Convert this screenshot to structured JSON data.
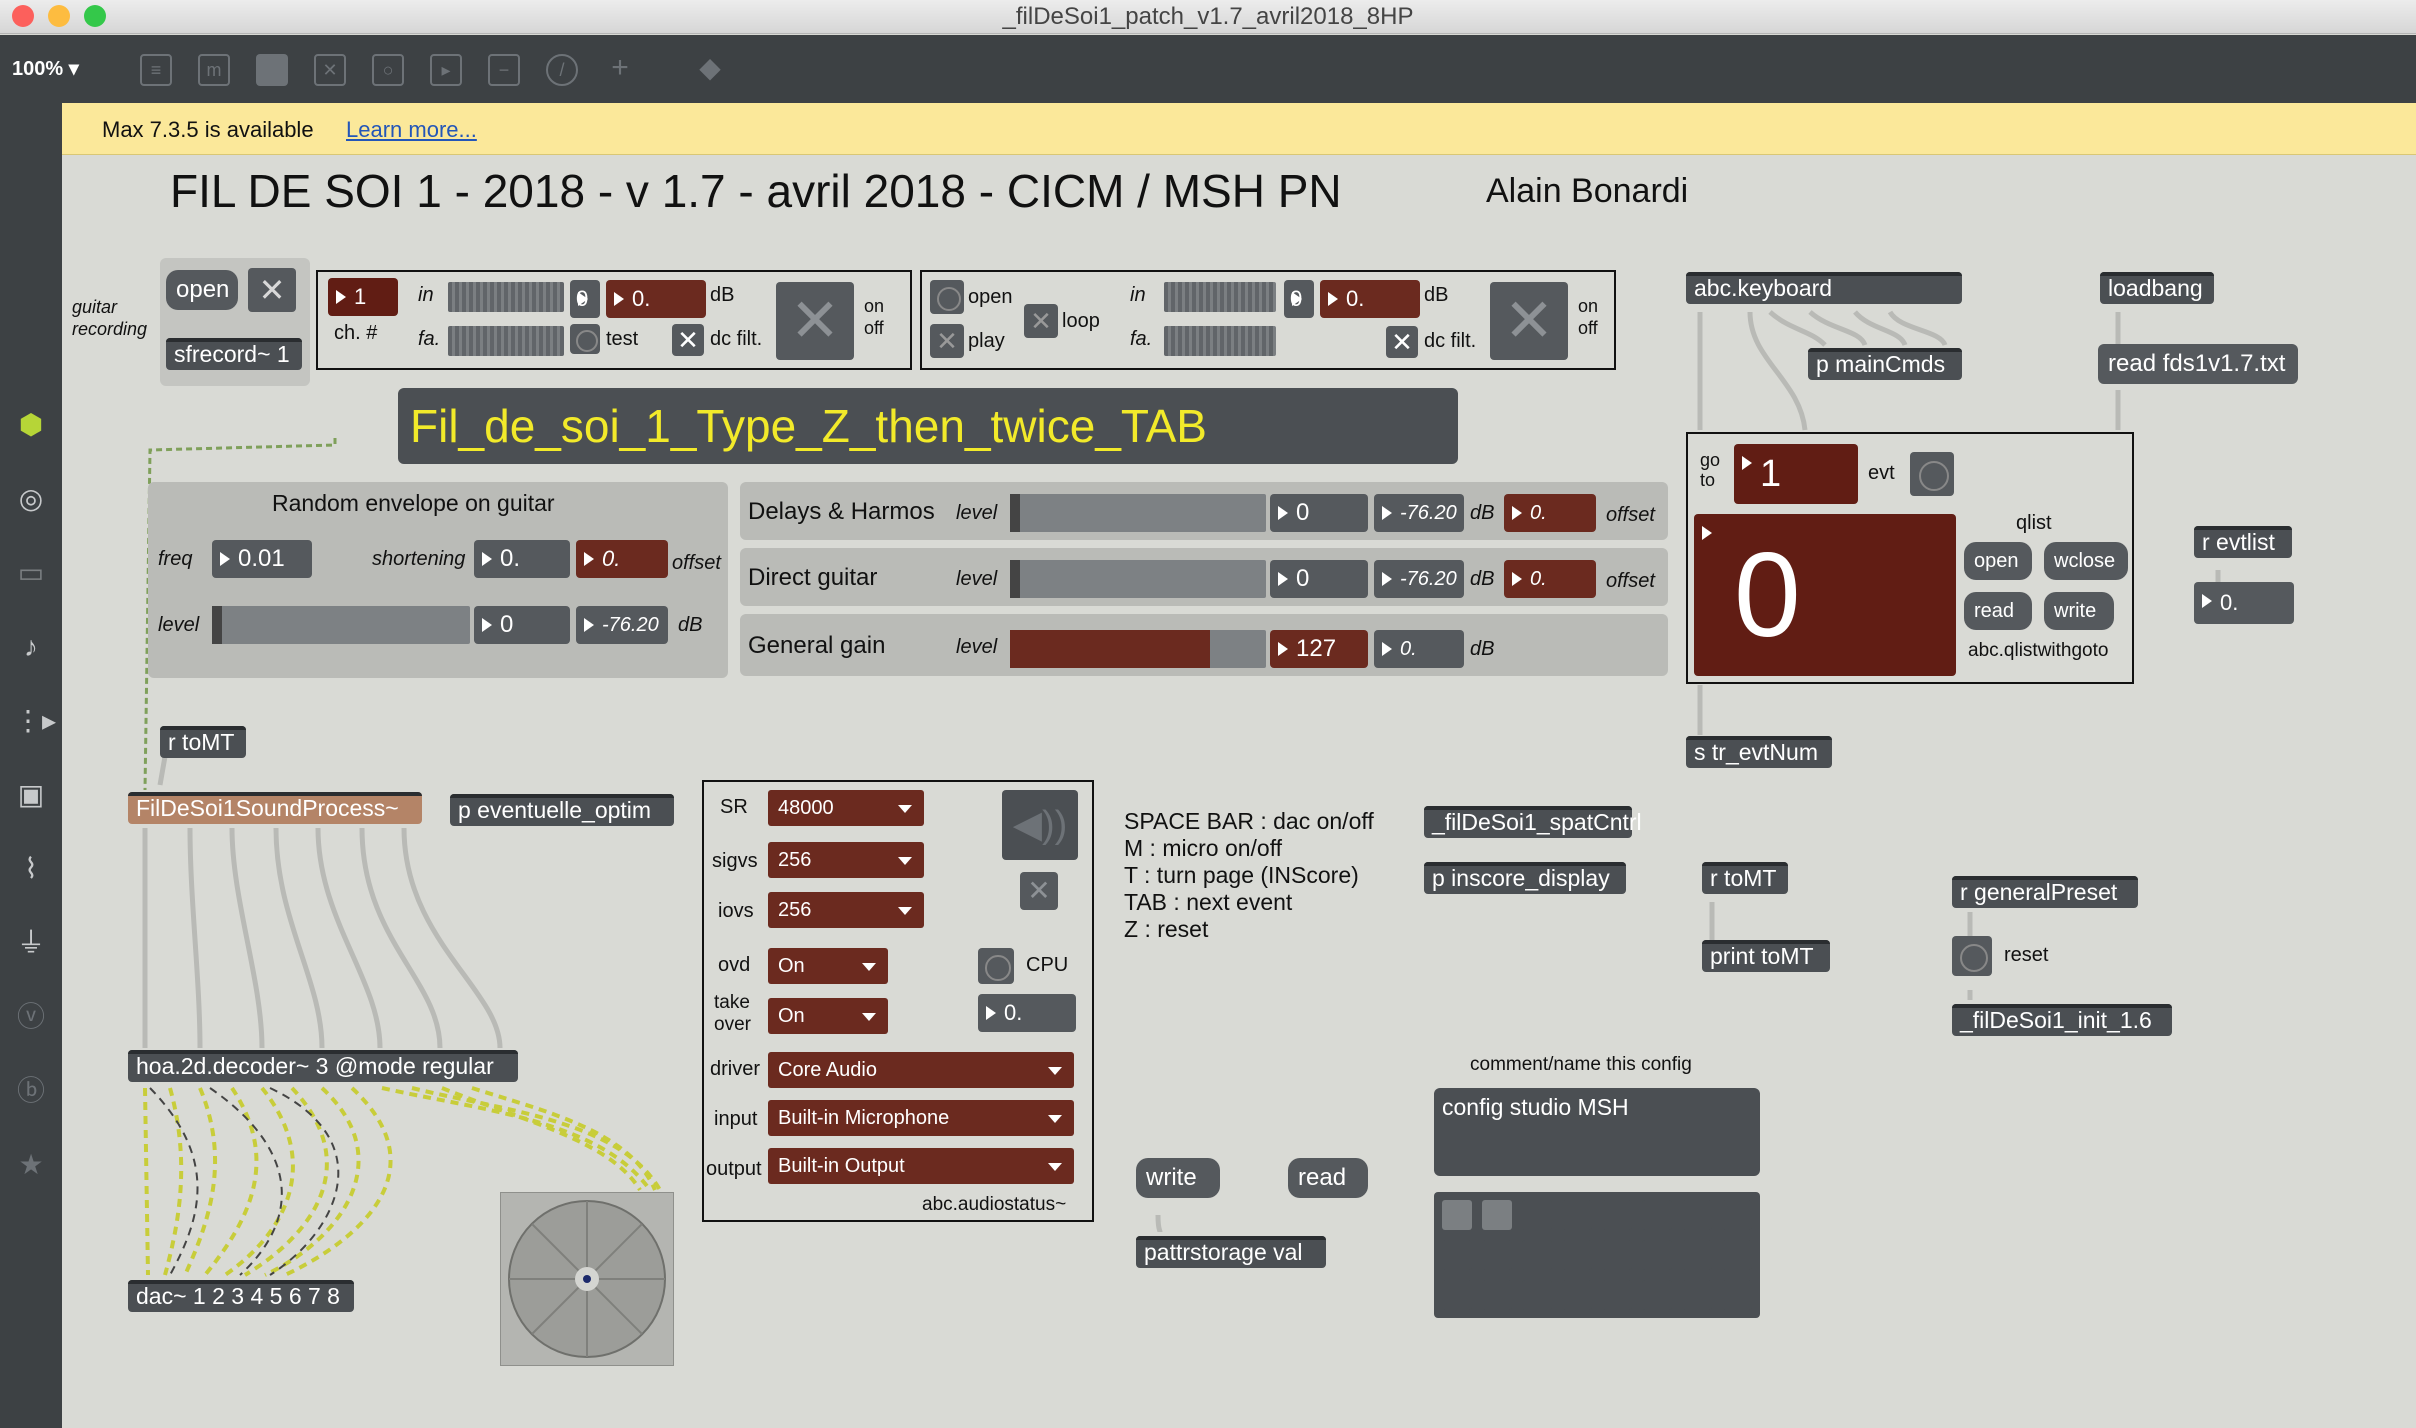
{
  "window": {
    "title": "_filDeSoi1_patch_v1.7_avril2018_8HP",
    "zoom": "100%"
  },
  "notice": {
    "text": "Max 7.3.5 is available",
    "link": "Learn more..."
  },
  "header": {
    "title": "FIL DE SOI 1 - 2018 - v 1.7 - avril 2018 - CICM / MSH PN",
    "author": "Alain Bonardi"
  },
  "recording": {
    "label": "guitar\nrecording",
    "open": "open",
    "sfrecord": "sfrecord~ 1"
  },
  "input1": {
    "ch": "1",
    "ch_label": "ch. #",
    "in": "in",
    "fa": "fa.",
    "zero": "0",
    "db_val": "0.",
    "db": "dB",
    "test": "test",
    "dcfilt": "dc filt.",
    "on": "on",
    "off": "off"
  },
  "input2": {
    "open": "open",
    "play": "play",
    "loop": "loop",
    "in": "in",
    "fa": "fa.",
    "zero": "0",
    "db_val": "0.",
    "db": "dB",
    "dcfilt": "dc filt.",
    "on": "on",
    "off": "off"
  },
  "banner": "Fil_de_soi_1_Type_Z_then_twice_TAB",
  "envelope": {
    "title": "Random envelope on guitar",
    "freq": "freq",
    "freq_val": "0.01",
    "shortening": "shortening",
    "short_val": "0.",
    "offset_val": "0.",
    "offset": "offset",
    "level": "level",
    "level_val": "0",
    "db_val": "-76.20",
    "db": "dB"
  },
  "mixer": [
    {
      "name": "Delays & Harmos",
      "level": "level",
      "val": "0",
      "db_val": "-76.20",
      "db": "dB",
      "off_val": "0.",
      "offset": "offset"
    },
    {
      "name": "Direct guitar",
      "level": "level",
      "val": "0",
      "db_val": "-76.20",
      "db": "dB",
      "off_val": "0.",
      "offset": "offset"
    },
    {
      "name": "General gain",
      "level": "level",
      "val": "127",
      "db_val": "0.",
      "db": "dB"
    }
  ],
  "objects": {
    "rtomt1": "r toMT",
    "soundprocess": "FilDeSoi1SoundProcess~",
    "eventuelle": "p eventuelle_optim",
    "decoder": "hoa.2d.decoder~ 3 @mode regular",
    "dac": "dac~ 1 2 3 4 5 6 7 8",
    "keyboard": "abc.keyboard",
    "maincmds": "p mainCmds",
    "loadbang": "loadbang",
    "readfds": "read fds1v1.7.txt",
    "evtnum": "s tr_evtNum",
    "revtlist": "r evtlist",
    "revtlist_val": "0.",
    "spatcntrl": "_filDeSoi1_spatCntrl",
    "inscore": "p inscore_display",
    "rtomt2": "r toMT",
    "printtomt": "print toMT",
    "rgeneral": "r generalPreset",
    "reset": "reset",
    "init": "_filDeSoi1_init_1.6",
    "write": "write",
    "read": "read",
    "pattr": "pattrstorage val"
  },
  "qlist": {
    "goto": "go\nto",
    "goto_val": "1",
    "evt": "evt",
    "qlist": "qlist",
    "big": "0",
    "open": "open",
    "wclose": "wclose",
    "read": "read",
    "write": "write",
    "name": "abc.qlistwithgoto"
  },
  "audio": {
    "sr_label": "SR",
    "sr": "48000",
    "sigvs_label": "sigvs",
    "sigvs": "256",
    "iovs_label": "iovs",
    "iovs": "256",
    "ovd_label": "ovd",
    "ovd": "On",
    "take_label": "take\nover",
    "take": "On",
    "cpu": "CPU",
    "cpu_val": "0.",
    "driver_label": "driver",
    "driver": "Core Audio",
    "input_label": "input",
    "input": "Built-in Microphone",
    "output_label": "output",
    "output": "Built-in Output",
    "name": "abc.audiostatus~"
  },
  "help": [
    "SPACE BAR : dac on/off",
    "M : micro on/off",
    "T : turn page (INScore)",
    "TAB : next event",
    "Z : reset"
  ],
  "config": {
    "comment": "comment/name this config",
    "name": "config studio MSH"
  }
}
